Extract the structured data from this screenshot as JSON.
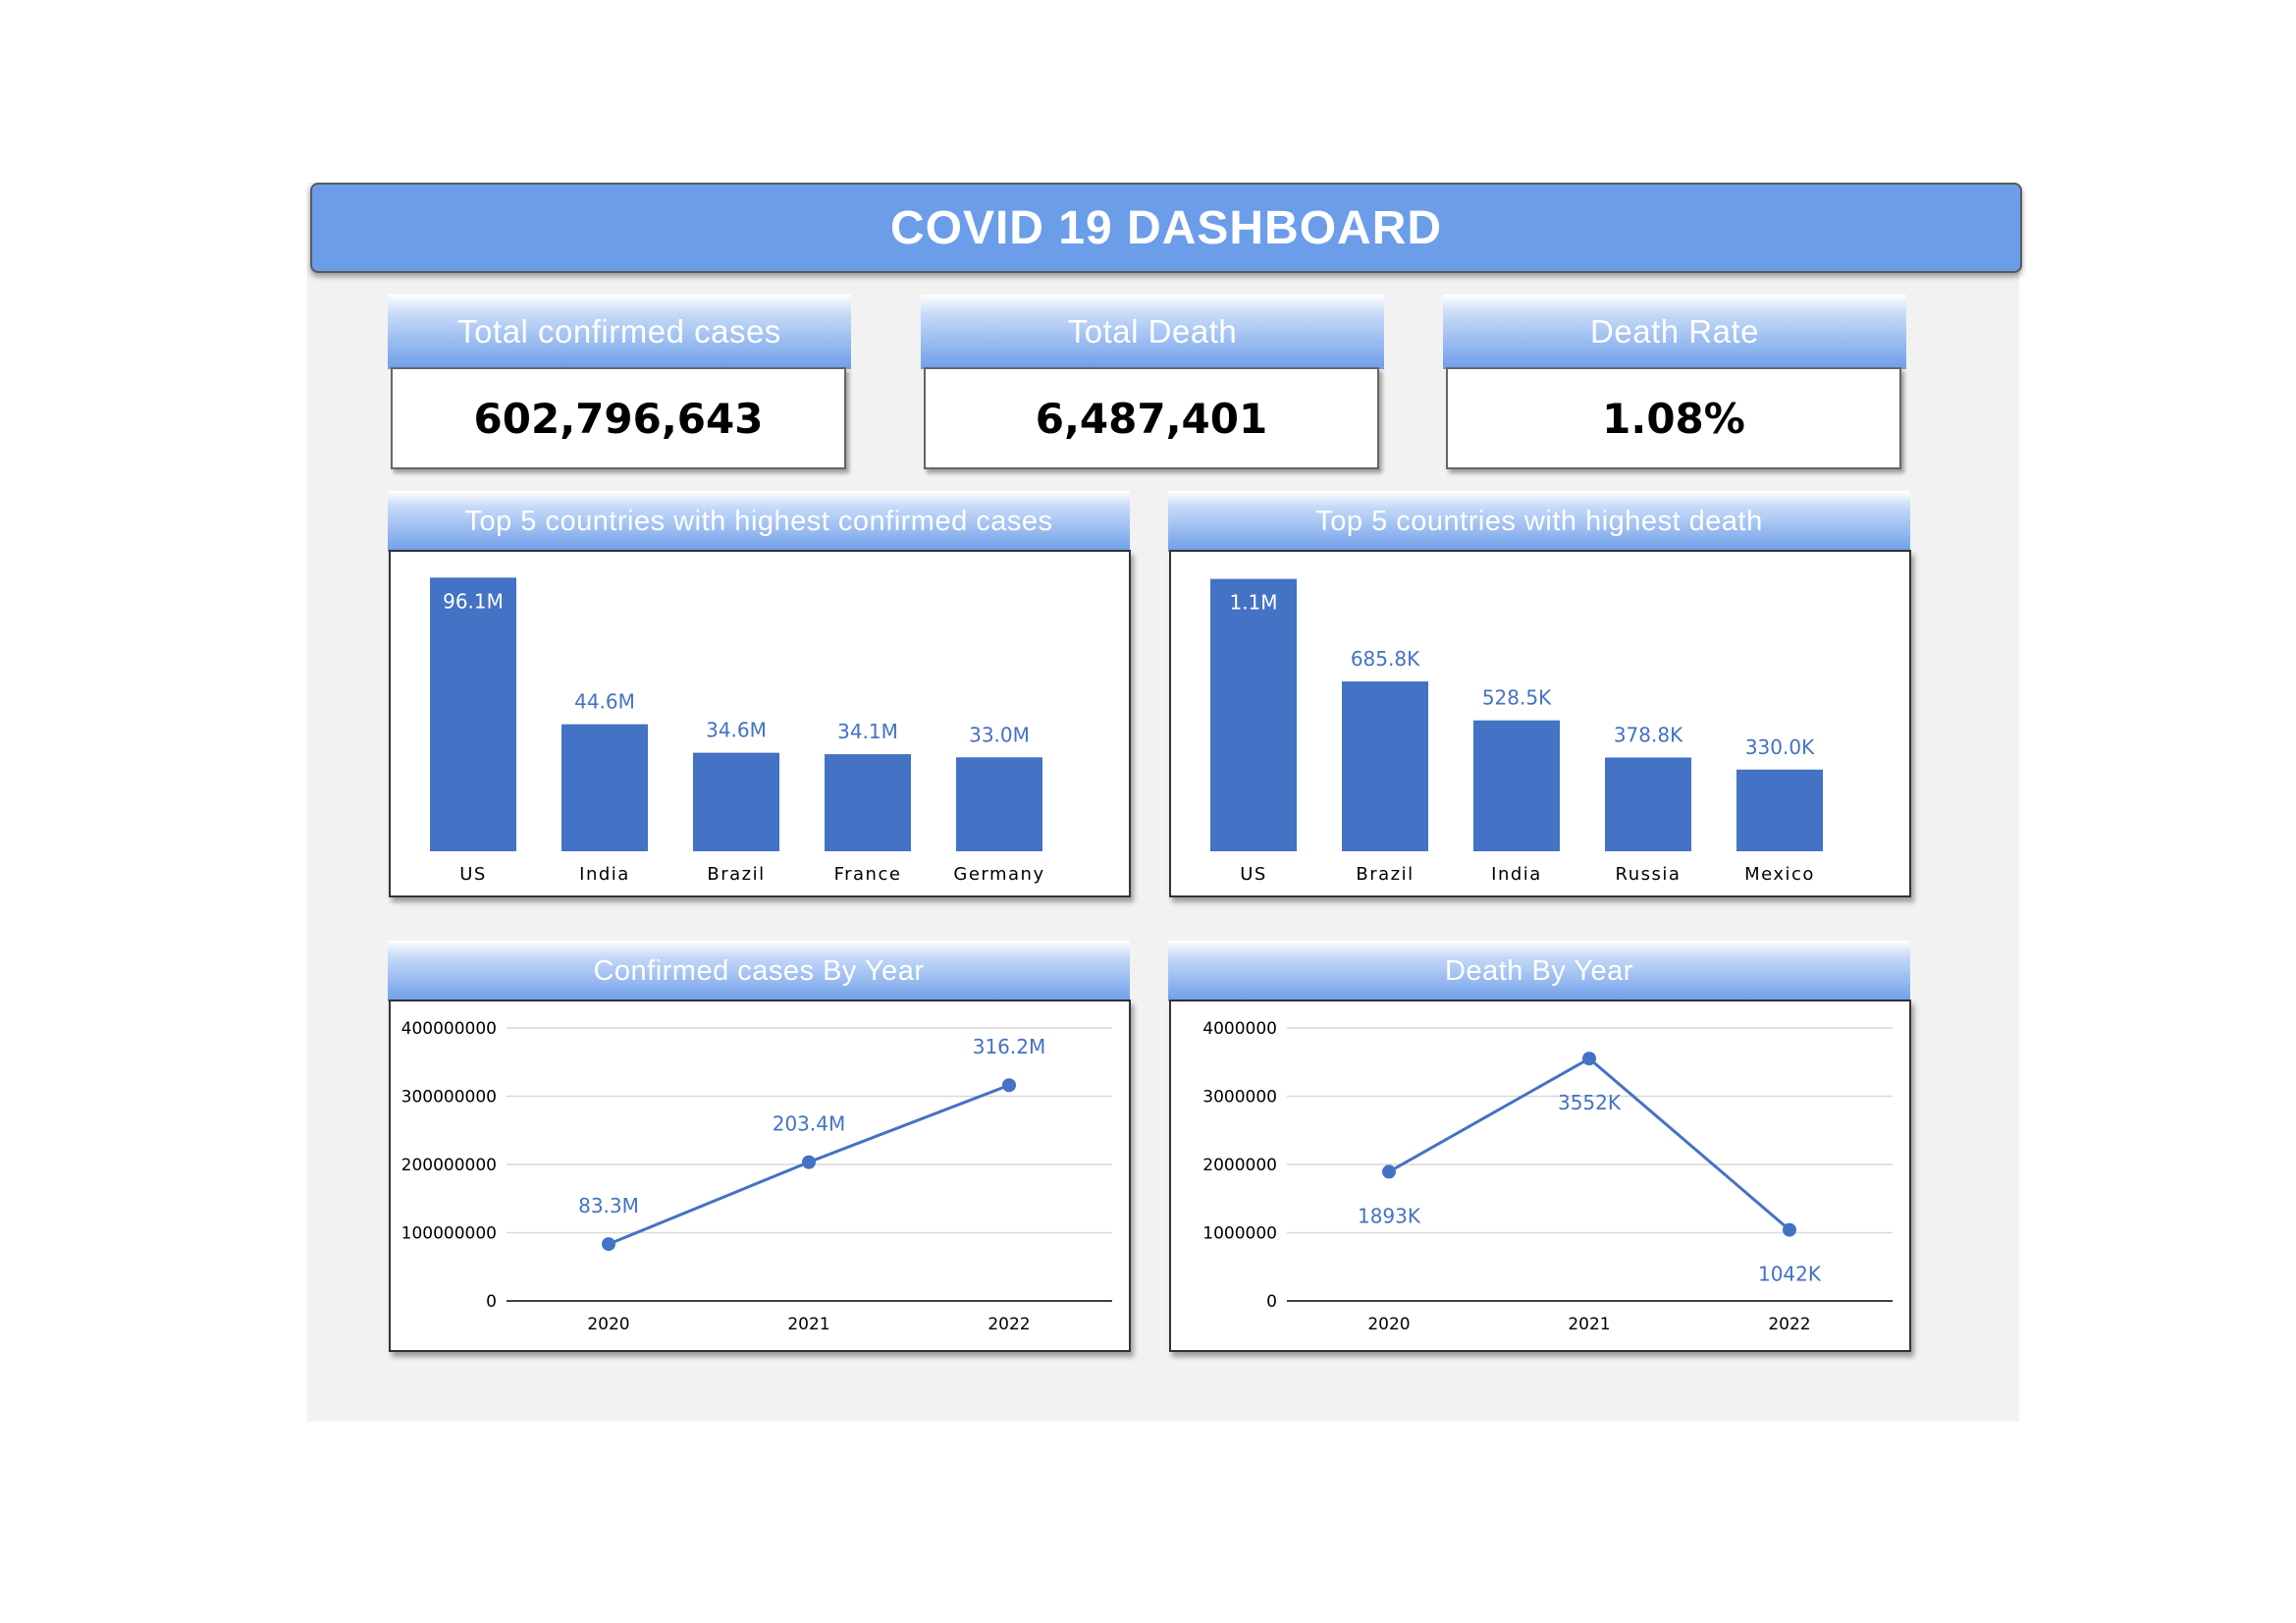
{
  "title": "COVID 19 DASHBOARD",
  "kpis": [
    {
      "label": "Total confirmed cases",
      "value": "602,796,643"
    },
    {
      "label": "Total Death",
      "value": "6,487,401"
    },
    {
      "label": "Death Rate",
      "value": "1.08%"
    }
  ],
  "colors": {
    "accent": "#4472c4",
    "header": "#6b9de8",
    "background": "#f2f2f2"
  },
  "panels": {
    "cases_bar": "Top 5 countries with highest confirmed cases",
    "death_bar": "Top 5 countries with highest death",
    "cases_line": "Confirmed cases By Year",
    "death_line": "Death By Year"
  },
  "chart_data": [
    {
      "type": "bar",
      "title": "Top 5 countries with highest confirmed cases",
      "categories": [
        "US",
        "India",
        "Brazil",
        "France",
        "Germany"
      ],
      "values": [
        96.1,
        44.6,
        34.6,
        34.1,
        33.0
      ],
      "labels": [
        "96.1M",
        "44.6M",
        "34.6M",
        "34.1M",
        "33.0M"
      ],
      "unit": "M",
      "ylim": [
        0,
        100
      ]
    },
    {
      "type": "bar",
      "title": "Top 5 countries with highest death",
      "categories": [
        "US",
        "Brazil",
        "India",
        "Russia",
        "Mexico"
      ],
      "values": [
        1100,
        685.8,
        528.5,
        378.8,
        330.0
      ],
      "labels": [
        "1.1M",
        "685.8K",
        "528.5K",
        "378.8K",
        "330.0K"
      ],
      "unit": "K",
      "ylim": [
        0,
        1150
      ]
    },
    {
      "type": "line",
      "title": "Confirmed cases By Year",
      "x": [
        "2020",
        "2021",
        "2022"
      ],
      "values": [
        83300000,
        203400000,
        316200000
      ],
      "labels": [
        "83.3M",
        "203.4M",
        "316.2M"
      ],
      "yticks": [
        "0",
        "100000000",
        "200000000",
        "300000000",
        "400000000"
      ],
      "ylim": [
        0,
        400000000
      ],
      "grid": true
    },
    {
      "type": "line",
      "title": "Death By Year",
      "x": [
        "2020",
        "2021",
        "2022"
      ],
      "values": [
        1893000,
        3552000,
        1042000
      ],
      "labels": [
        "1893K",
        "3552K",
        "1042K"
      ],
      "yticks": [
        "0",
        "1000000",
        "2000000",
        "3000000",
        "4000000"
      ],
      "ylim": [
        0,
        4000000
      ],
      "grid": true
    }
  ]
}
